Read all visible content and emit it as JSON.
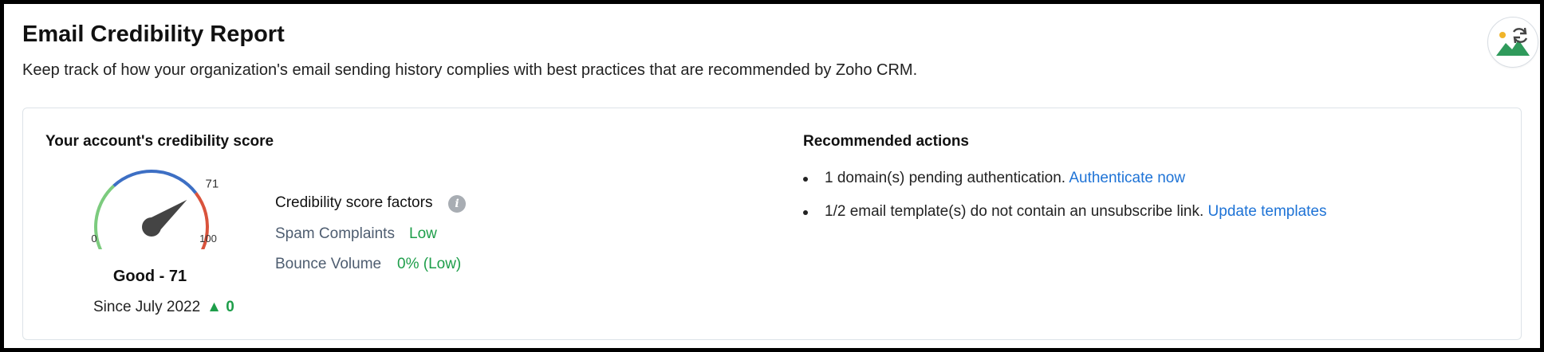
{
  "header": {
    "title": "Email Credibility Report",
    "description": "Keep track of how your organization's email sending history complies with best practices that are recommended by Zoho CRM.",
    "corner_icon": "image-refresh-icon"
  },
  "score": {
    "heading": "Your account's credibility score",
    "value": 71,
    "min_label": "0",
    "max_label": "100",
    "value_label": "71",
    "grade_label": "Good - 71",
    "since_label": "Since July 2022",
    "delta_arrow": "▲",
    "delta_value": "0",
    "gauge_colors": [
      "#7ccb7e",
      "#3d6fc4",
      "#d9533c"
    ]
  },
  "factors": {
    "title": "Credibility score factors",
    "info_icon": "i",
    "items": [
      {
        "name": "Spam Complaints",
        "value": "Low"
      },
      {
        "name": "Bounce Volume",
        "value": "0% (Low)"
      }
    ]
  },
  "recommended": {
    "heading": "Recommended actions",
    "items": [
      {
        "text": "1 domain(s) pending authentication.",
        "link": "Authenticate now"
      },
      {
        "text": "1/2 email template(s) do not contain an unsubscribe link.",
        "link": "Update templates"
      }
    ]
  },
  "colors": {
    "link": "#1e73d6",
    "positive": "#1e9e4a",
    "factor_name": "#4e5d70"
  }
}
